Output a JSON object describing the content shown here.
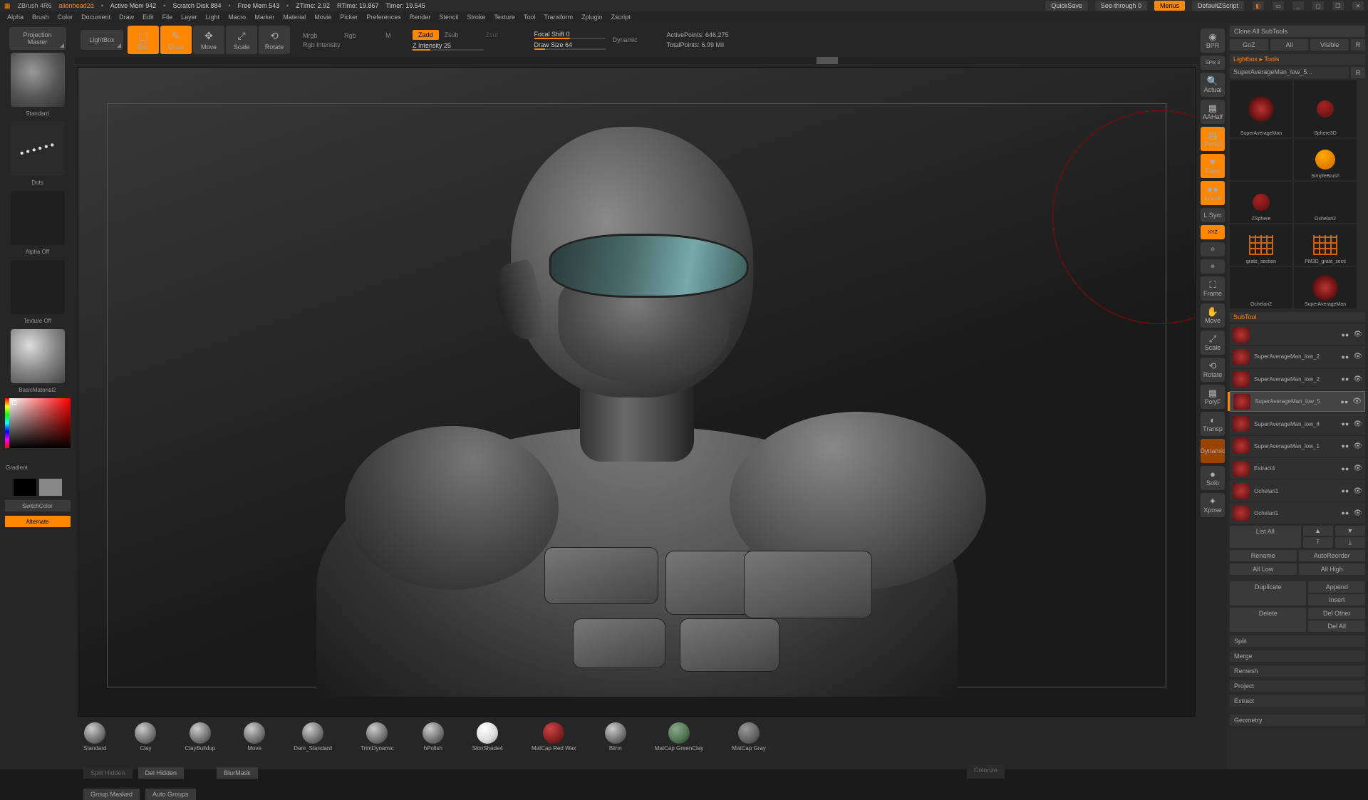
{
  "titlebar": {
    "app": "ZBrush 4R6",
    "file": "alienhead2d",
    "stats": [
      "Active Mem 942",
      "Scratch Disk 884",
      "Free Mem 543",
      "ZTime: 2.92",
      "RTime: 19.867",
      "Timer: 19.545"
    ],
    "quicksave": "QuickSave",
    "seethrough": "See-through  0",
    "menus": "Menus",
    "zscript": "DefaultZScript"
  },
  "menubar": [
    "Alpha",
    "Brush",
    "Color",
    "Document",
    "Draw",
    "Edit",
    "File",
    "Layer",
    "Light",
    "Macro",
    "Marker",
    "Material",
    "Movie",
    "Picker",
    "Preferences",
    "Render",
    "Stencil",
    "Stroke",
    "Texture",
    "Tool",
    "Transform",
    "Zplugin",
    "Zscript"
  ],
  "left": {
    "projection": "Projection\nMaster",
    "lightbox": "LightBox",
    "brush_label": "Standard",
    "stroke_label": "Dots",
    "alpha_label": "Alpha Off",
    "texture_label": "Texture Off",
    "material_label": "BasicMaterial2",
    "gradient": "Gradient",
    "switchcolor": "SwitchColor",
    "alternate": "Alternate"
  },
  "top": {
    "modes": [
      {
        "label": "Edit",
        "on": true
      },
      {
        "label": "Draw",
        "on": true
      },
      {
        "label": "Move",
        "on": false
      },
      {
        "label": "Scale",
        "on": false
      },
      {
        "label": "Rotate",
        "on": false
      }
    ],
    "mrgb": "Mrgb",
    "rgb": "Rgb",
    "m": "M",
    "rgb_intensity": "Rgb Intensity",
    "zadd": "Zadd",
    "zsub": "Zsub",
    "zcut": "Zcut",
    "z_intensity": "Z Intensity 25",
    "focal": "Focal Shift 0",
    "draw_size": "Draw Size 64",
    "dynamic": "Dynamic",
    "active_points": "ActivePoints: 646,275",
    "total_points": "TotalPoints: 6.99 Mil"
  },
  "side": {
    "bpr": "BPR",
    "spix": "SPix 3",
    "actual": "Actual",
    "aahalf": "AAHalf",
    "persp": "Persp",
    "floor": "Floor",
    "local": "Local",
    "lsym": "L.Sym",
    "xyz": "XYZ",
    "frame": "Frame",
    "move": "Move",
    "scale": "Scale",
    "rotate": "Rotate",
    "polyf": "PolyF",
    "transp": "Transp",
    "dynamic": "Dynamic",
    "solo": "Solo",
    "xpose": "Xpose"
  },
  "right": {
    "clone": "Clone All SubTools",
    "goz": "GoZ",
    "all": "All",
    "visible": "Visible",
    "r": "R",
    "lightbox_tools": "Lightbox ▸ Tools",
    "current_tool": "SuperAverageMan_low_5...",
    "tools": [
      {
        "label": "SuperAverageMan",
        "kind": "figure"
      },
      {
        "label": "Sphere3D",
        "kind": "sphere"
      },
      {
        "label": "",
        "kind": "blank"
      },
      {
        "label": "SimpleBrush",
        "kind": "sbrush"
      },
      {
        "label": "ZSphere",
        "kind": "sphere"
      },
      {
        "label": "Ochelari2",
        "kind": "blank"
      },
      {
        "label": "grate_section",
        "kind": "grid"
      },
      {
        "label": "PM3D_grate_secti",
        "kind": "grid"
      },
      {
        "label": "Ochelari2",
        "kind": "blank"
      },
      {
        "label": "SuperAverageMan",
        "kind": "figure"
      }
    ],
    "subtool_header": "SubTool",
    "subtools": [
      {
        "name": "",
        "active": false
      },
      {
        "name": "SuperAverageMan_low_2",
        "active": false
      },
      {
        "name": "SuperAverageMan_low_2",
        "active": false
      },
      {
        "name": "SuperAverageMan_low_5",
        "active": true
      },
      {
        "name": "SuperAverageMan_low_4",
        "active": false
      },
      {
        "name": "SuperAverageMan_low_1",
        "active": false
      },
      {
        "name": "Extract4",
        "active": false
      },
      {
        "name": "Ochelari1",
        "active": false
      },
      {
        "name": "Ochelari1",
        "active": false
      }
    ],
    "list_all": "List All",
    "rename": "Rename",
    "autoreorder": "AutoReorder",
    "all_low": "All Low",
    "all_high": "All High",
    "duplicate": "Duplicate",
    "append": "Append",
    "insert": "Insert",
    "delete": "Delete",
    "del_other": "Del Other",
    "del_all": "Del All",
    "split": "Split",
    "merge": "Merge",
    "remesh": "Remesh",
    "project": "Project",
    "extract": "Extract",
    "geometry": "Geometry"
  },
  "bottom": {
    "brushes": [
      {
        "name": "Standard",
        "cls": ""
      },
      {
        "name": "Clay",
        "cls": ""
      },
      {
        "name": "ClayBuildup",
        "cls": ""
      },
      {
        "name": "Move",
        "cls": ""
      },
      {
        "name": "Dam_Standard",
        "cls": ""
      },
      {
        "name": "TrimDynamic",
        "cls": ""
      },
      {
        "name": "hPolish",
        "cls": ""
      },
      {
        "name": "SkinShade4",
        "cls": "white"
      },
      {
        "name": "MatCap Red Wax",
        "cls": "red"
      },
      {
        "name": "Blinn",
        "cls": ""
      },
      {
        "name": "MatCap GreenClay",
        "cls": "green"
      },
      {
        "name": "MatCap Gray",
        "cls": "gray"
      }
    ],
    "split_hidden": "Split Hidden",
    "del_hidden": "Del Hidden",
    "blurmask": "BlurMask",
    "group_masked": "Group Masked",
    "auto_groups": "Auto Groups",
    "colorize": "Colorize"
  }
}
